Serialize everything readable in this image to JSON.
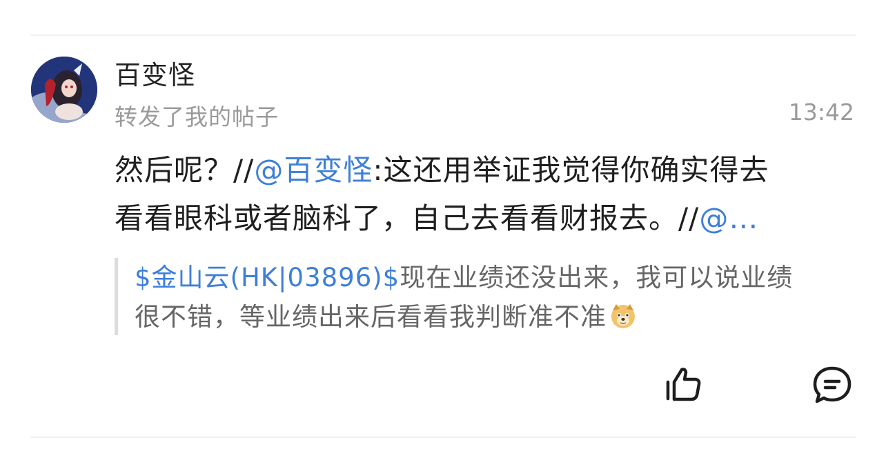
{
  "post": {
    "username": "百变怪",
    "action_text": "转发了我的帖子",
    "time": "13:42",
    "content_line1_prefix": "然后呢？//",
    "content_line1_mention": "@百变怪",
    "content_line1_suffix": ":这还用举证我觉得你确实得去",
    "content_line2_prefix": "看看眼科或者脑科了，自己去看看财报去。//",
    "content_line2_mention": "@…"
  },
  "quote": {
    "stock_tag": "$金山云(HK|03896)$",
    "line1_rest": "现在业绩还没出来，我可以说业绩",
    "line2": "很不错，等业绩出来后看看我判断准不准",
    "emoji_icon": "doge-emoji-icon"
  },
  "actions": {
    "like_icon": "thumbs-up-icon",
    "comment_icon": "comment-icon"
  },
  "colors": {
    "mention": "#3d7fd9",
    "secondary_text": "#9a9a9a",
    "quote_bar": "#dcdcdc"
  }
}
